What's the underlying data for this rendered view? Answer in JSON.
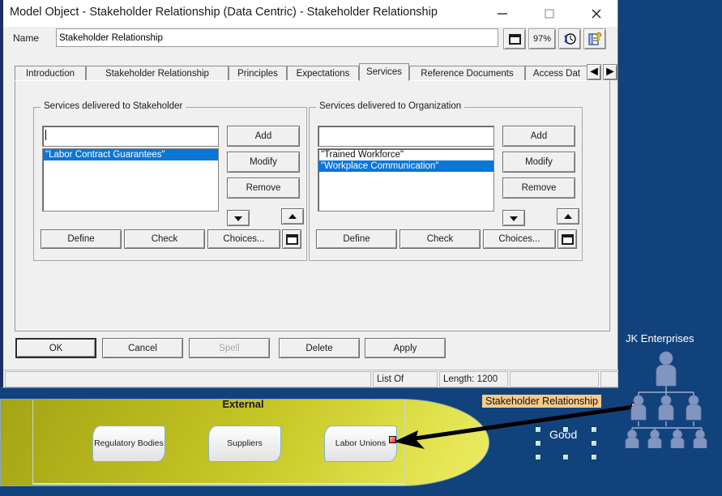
{
  "window": {
    "title": "Model Object - Stakeholder Relationship (Data Centric) - Stakeholder Relationship",
    "minimize_label": "—",
    "maximize_label": "□",
    "close_label": "✕"
  },
  "name_row": {
    "label": "Name",
    "value": "Stakeholder Relationship",
    "zoom_label": "97%"
  },
  "tabs": [
    {
      "label": "Introduction",
      "active": false
    },
    {
      "label": "Stakeholder Relationship",
      "active": false
    },
    {
      "label": "Principles",
      "active": false
    },
    {
      "label": "Expectations",
      "active": false
    },
    {
      "label": "Services",
      "active": true
    },
    {
      "label": "Reference Documents",
      "active": false
    },
    {
      "label": "Access Dat",
      "active": false
    }
  ],
  "tab_scroll": {
    "left": "◄",
    "right": "►"
  },
  "left_group": {
    "title": "Services delivered to Stakeholder",
    "edit_value": "",
    "items": [
      {
        "text": "\"Labor Contract Guarantees\"",
        "selected": true
      }
    ],
    "add_label": "Add",
    "modify_label": "Modify",
    "remove_label": "Remove",
    "down_label": "▼",
    "up_label": "▲",
    "define_label": "Define",
    "check_label": "Check",
    "choices_label": "Choices..."
  },
  "right_group": {
    "title": "Services delivered to Organization",
    "edit_value": "",
    "items": [
      {
        "text": "\"Trained Workforce\"",
        "selected": false
      },
      {
        "text": "\"Workplace Communication\"",
        "selected": true
      }
    ],
    "add_label": "Add",
    "modify_label": "Modify",
    "remove_label": "Remove",
    "down_label": "▼",
    "up_label": "▲",
    "define_label": "Define",
    "check_label": "Check",
    "choices_label": "Choices..."
  },
  "dialog_buttons": {
    "ok": "OK",
    "cancel": "Cancel",
    "spell": "Spell",
    "delete": "Delete",
    "apply": "Apply"
  },
  "statusbar": {
    "message": "",
    "type": "List Of",
    "length": "Length: 1200",
    "extra": "",
    "end": ""
  },
  "diagram": {
    "pill_label": "External",
    "nodes": [
      {
        "label": "Regulatory Bodies"
      },
      {
        "label": "Suppliers"
      },
      {
        "label": "Labor Unions"
      }
    ],
    "relationship_label": "Stakeholder Relationship",
    "quality_label": "Good",
    "org_title": "JK Enterprises",
    "colors": {
      "canvas": "#11427c",
      "pill_start": "#a4a417",
      "pill_end": "#ecec66",
      "label_bg": "#f7c98a",
      "handle": "#ff2222",
      "selection_handle": "#9fd2ef",
      "org_person": "#8295c0"
    }
  }
}
